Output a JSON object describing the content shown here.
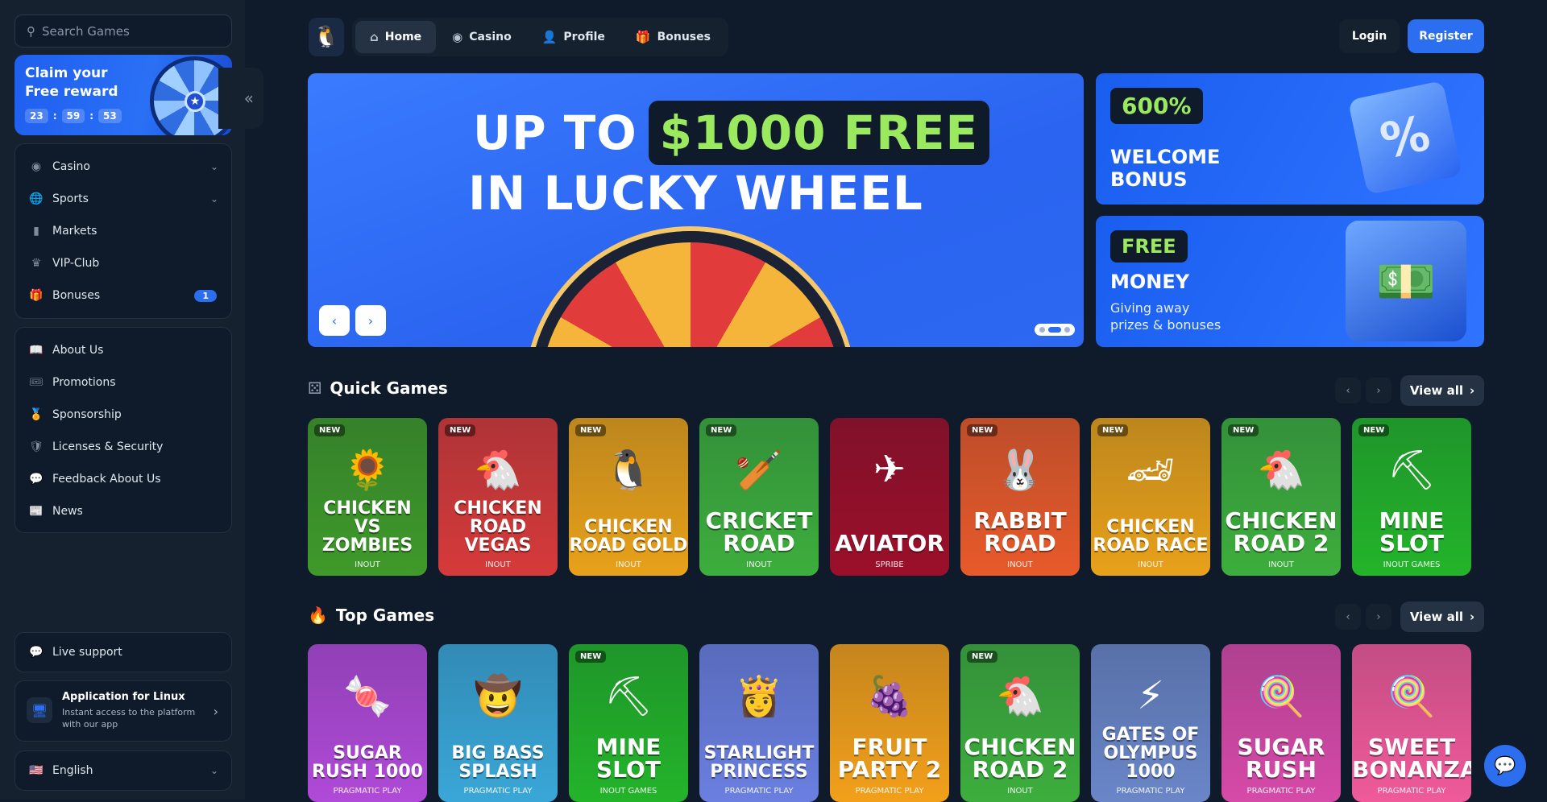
{
  "search": {
    "placeholder": "Search Games"
  },
  "reward": {
    "title": "Claim your Free reward",
    "timer": [
      "23",
      "59",
      "53"
    ]
  },
  "sidebar": {
    "main": [
      {
        "label": "Casino",
        "icon": "casino-icon",
        "chevron": true
      },
      {
        "label": "Sports",
        "icon": "globe-icon",
        "chevron": true
      },
      {
        "label": "Markets",
        "icon": "chart-icon"
      },
      {
        "label": "VIP-Club",
        "icon": "crown-icon"
      },
      {
        "label": "Bonuses",
        "icon": "gift-icon",
        "badge": "1"
      }
    ],
    "secondary": [
      {
        "label": "About Us",
        "icon": "book-icon"
      },
      {
        "label": "Promotions",
        "icon": "ticket-icon"
      },
      {
        "label": "Sponsorship",
        "icon": "medal-icon"
      },
      {
        "label": "Licenses & Security",
        "icon": "shield-icon"
      },
      {
        "label": "Feedback About Us",
        "icon": "feedback-icon"
      },
      {
        "label": "News",
        "icon": "news-icon"
      }
    ],
    "support": "Live support",
    "app": {
      "title": "Application for Linux",
      "desc": "Instant access to the platform with our app"
    },
    "language": "English"
  },
  "topnav": {
    "tabs": [
      "Home",
      "Casino",
      "Profile",
      "Bonuses"
    ],
    "login": "Login",
    "register": "Register"
  },
  "hero": {
    "line1a": "UP TO",
    "line1b": "$1000 FREE",
    "line2": "IN LUCKY WHEEL"
  },
  "promos": [
    {
      "pill": "600%",
      "title1": "WELCOME",
      "title2": "BONUS"
    },
    {
      "pill": "FREE",
      "title1": "MONEY",
      "sub1": "Giving away",
      "sub2": "prizes & bonuses"
    }
  ],
  "quick": {
    "title": "Quick Games",
    "view_all": "View all",
    "games": [
      {
        "name": "CHICKEN VS ZOMBIES",
        "provider": "INOUT",
        "new": true,
        "color": "#3f9a2a",
        "emoji": "🌻"
      },
      {
        "name": "CHICKEN ROAD VEGAS",
        "provider": "INOUT",
        "new": true,
        "color": "#d63a3a",
        "emoji": "🐔"
      },
      {
        "name": "CHICKEN ROAD GOLD",
        "provider": "INOUT",
        "new": true,
        "color": "#e8a11a",
        "emoji": "🐧"
      },
      {
        "name": "CRICKET ROAD",
        "provider": "INOUT",
        "new": true,
        "color": "#3dae3d",
        "emoji": "🏏"
      },
      {
        "name": "AVIATOR",
        "provider": "SPRIBE",
        "new": false,
        "color": "#9c0f2a",
        "emoji": "✈"
      },
      {
        "name": "RABBIT ROAD",
        "provider": "INOUT",
        "new": true,
        "color": "#e85a2a",
        "emoji": "🐰"
      },
      {
        "name": "CHICKEN ROAD RACE",
        "provider": "INOUT",
        "new": true,
        "color": "#e8a11a",
        "emoji": "🏎"
      },
      {
        "name": "CHICKEN ROAD 2",
        "provider": "INOUT",
        "new": true,
        "color": "#3dae3d",
        "emoji": "🐔"
      },
      {
        "name": "MINE SLOT",
        "provider": "INOUT GAMES",
        "new": true,
        "color": "#23b42a",
        "emoji": "⛏"
      }
    ]
  },
  "top": {
    "title": "Top Games",
    "view_all": "View all",
    "games": [
      {
        "name": "SUGAR RUSH 1000",
        "provider": "PRAGMATIC PLAY",
        "new": false,
        "color": "#b04ad8",
        "emoji": "🍬"
      },
      {
        "name": "BIG BASS SPLASH",
        "provider": "PRAGMATIC PLAY",
        "new": false,
        "color": "#3aa7d8",
        "emoji": "🤠"
      },
      {
        "name": "MINE SLOT",
        "provider": "INOUT GAMES",
        "new": true,
        "color": "#23b42a",
        "emoji": "⛏"
      },
      {
        "name": "STARLIGHT PRINCESS",
        "provider": "PRAGMATIC PLAY",
        "new": false,
        "color": "#6a7fe0",
        "emoji": "👸"
      },
      {
        "name": "FRUIT PARTY 2",
        "provider": "PRAGMATIC PLAY",
        "new": false,
        "color": "#f2a01a",
        "emoji": "🍇"
      },
      {
        "name": "CHICKEN ROAD 2",
        "provider": "INOUT",
        "new": true,
        "color": "#3dae3d",
        "emoji": "🐔"
      },
      {
        "name": "GATES OF OLYMPUS 1000",
        "provider": "PRAGMATIC PLAY",
        "new": false,
        "color": "#6a86c8",
        "emoji": "⚡"
      },
      {
        "name": "SUGAR RUSH",
        "provider": "PRAGMATIC PLAY",
        "new": false,
        "color": "#d64aa8",
        "emoji": "🍭"
      },
      {
        "name": "SWEET BONANZA",
        "provider": "PRAGMATIC PLAY",
        "new": false,
        "color": "#f05a9a",
        "emoji": "🍭"
      }
    ]
  }
}
